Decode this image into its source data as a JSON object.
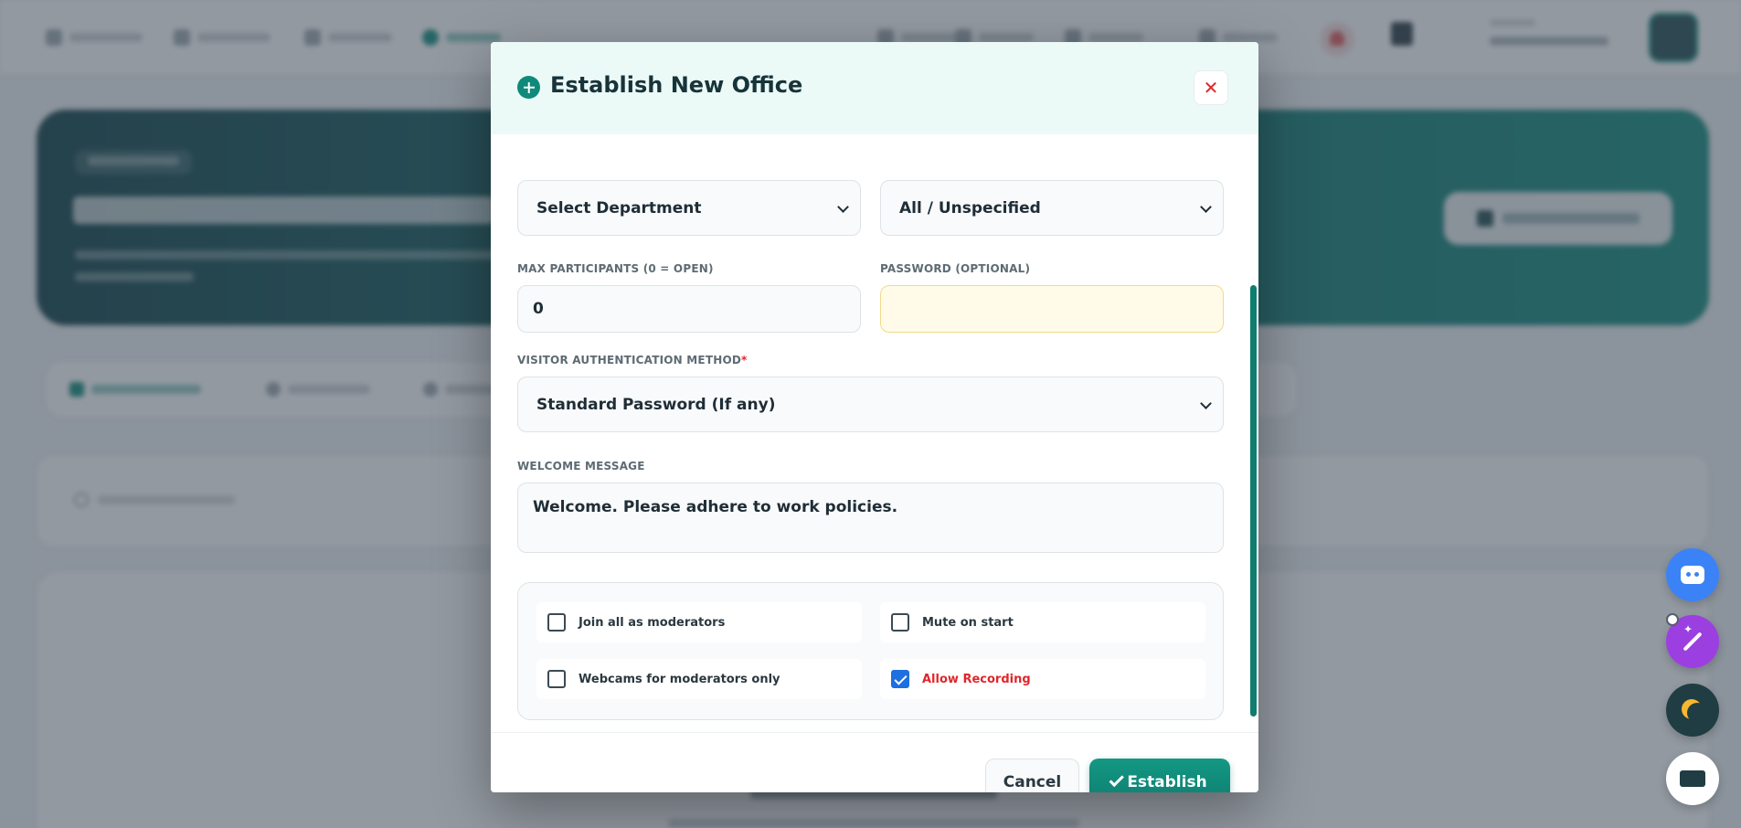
{
  "modal": {
    "title": "Establish New Office",
    "close_label": "✕",
    "department_select": "Select Department",
    "scope_select": "All / Unspecified",
    "max_participants_label": "MAX PARTICIPANTS (0 = OPEN)",
    "max_participants_value": "0",
    "password_label": "PASSWORD (OPTIONAL)",
    "password_value": "",
    "auth_label": "VISITOR AUTHENTICATION METHOD",
    "auth_required_mark": "*",
    "auth_select": "Standard Password (If any)",
    "welcome_label": "WELCOME MESSAGE",
    "welcome_value": "Welcome. Please adhere to work policies.",
    "options": [
      {
        "label": "Join all as moderators",
        "checked": false
      },
      {
        "label": "Mute on start",
        "checked": false
      },
      {
        "label": "Webcams for moderators only",
        "checked": false
      },
      {
        "label": "Allow Recording",
        "checked": true
      }
    ],
    "cancel_label": "Cancel",
    "establish_label": "Establish"
  },
  "colors": {
    "accent": "#0f8a7a",
    "danger": "#e0262b",
    "checkbox_checked": "#1e6fe0",
    "password_bg": "#fffbe8"
  },
  "icons": [
    "plus-circle-icon",
    "close-icon",
    "chevron-down-icon",
    "check-icon",
    "robot-icon",
    "magic-wand-icon",
    "moon-icon",
    "screen-icon"
  ]
}
